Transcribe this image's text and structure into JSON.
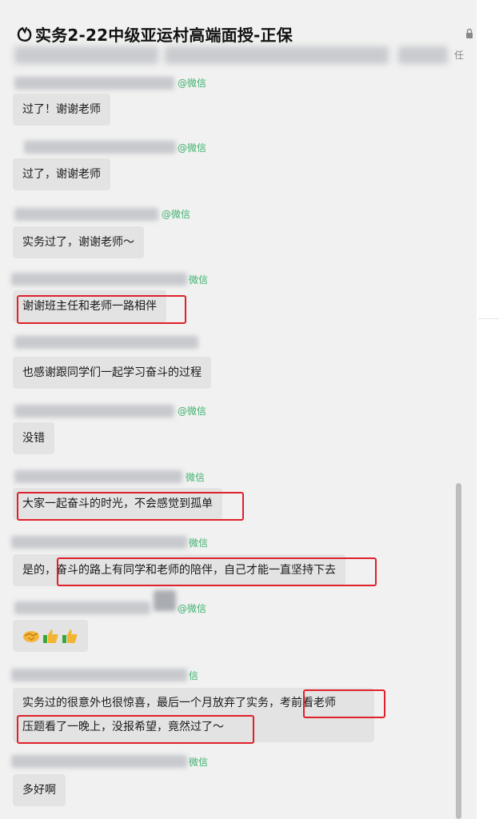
{
  "window": {
    "title": "实务2-22中级亚运村高端面授-正保",
    "subtitle_tail": "任"
  },
  "messages": [
    {
      "text": "过了！谢谢老师",
      "source": "@微信"
    },
    {
      "text": "过了，谢谢老师",
      "source": "@微信"
    },
    {
      "text": "实务过了，谢谢老师～",
      "source": "@微信"
    },
    {
      "text": "谢谢班主任和老师一路相伴",
      "source": "微信"
    },
    {
      "text": "也感谢跟同学们一起学习奋斗的过程",
      "source": ""
    },
    {
      "text": "没错",
      "source": "@微信"
    },
    {
      "text": "大家一起奋斗的时光，不会感觉到孤单",
      "source": "微信"
    },
    {
      "text_prefix": "是的，",
      "text": "奋斗的路上有同学和老师的陪伴，自己才能一直坚持下去",
      "source": "微信"
    },
    {
      "emojis": [
        "handshake-icon",
        "thumbs-up-icon",
        "thumbs-up-icon"
      ],
      "source": "@微信"
    },
    {
      "line1": "实务过的很意外也很惊喜，最后一个月放弃了实务，考前看老师",
      "line2": "压题看了一晚上，没报希望，竟然过了～",
      "source": "信"
    },
    {
      "text": "多好啊",
      "source": "微信"
    }
  ],
  "colors": {
    "highlight": "#e0202a",
    "source_green": "#3fb26f",
    "bubble": "#e3e3e3",
    "panel": "#f1f1f1"
  }
}
